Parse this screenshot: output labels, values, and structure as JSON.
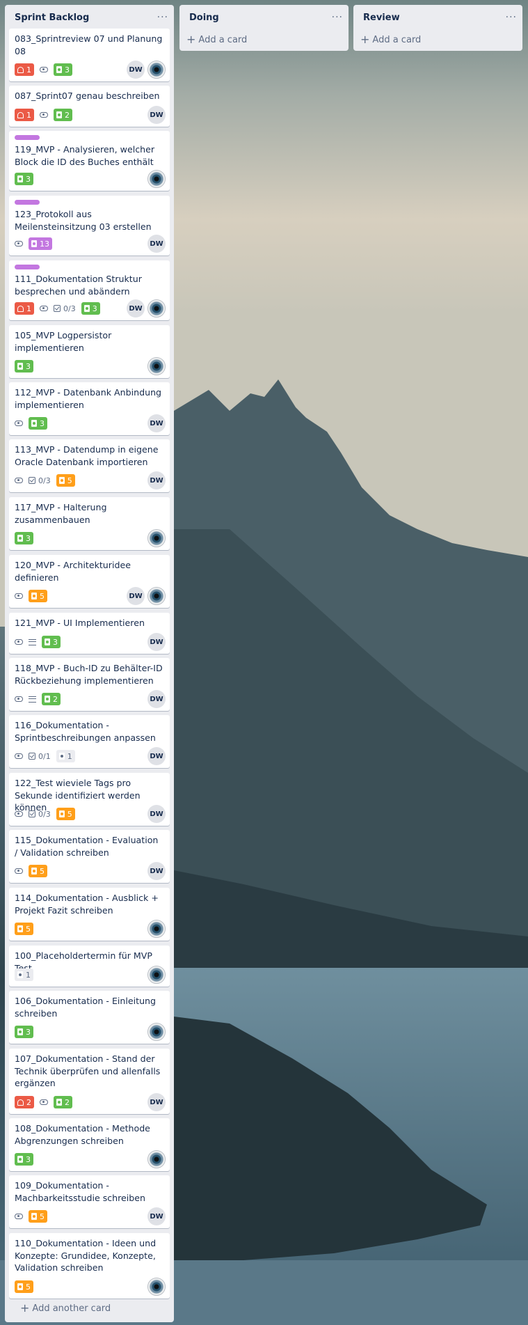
{
  "lists": [
    {
      "title": "Sprint Backlog",
      "add_label": "Add another card"
    },
    {
      "title": "Doing",
      "add_label": "Add a card"
    },
    {
      "title": "Review",
      "add_label": "Add a card"
    }
  ],
  "icons": {
    "menu": "ellipsis-icon",
    "add": "plus-icon",
    "watch": "eye-icon",
    "description": "description-icon",
    "checklist": "checklist-icon",
    "due": "bell-icon",
    "points": "story-points-icon"
  },
  "colors": {
    "red": "#eb5a46",
    "green": "#61bd4f",
    "orange": "#ff9f1a",
    "purple": "#c377e0",
    "list_bg": "#ebecf0"
  },
  "member_initials": "DW",
  "cards": [
    {
      "title": "083_Sprintreview 07 und Planung 08",
      "due": "1",
      "points": "3",
      "points_color": "green"
    },
    {
      "title": "087_Sprint07 genau beschreiben",
      "due": "1",
      "points": "2",
      "points_color": "green"
    },
    {
      "title": "119_MVP - Analysieren, welcher Block die ID des Buches enthält",
      "points": "3",
      "points_color": "green"
    },
    {
      "title": "123_Protokoll aus Meilensteinsitzung 03 erstellen",
      "points": "13",
      "points_color": "purple"
    },
    {
      "title": "111_Dokumentation Struktur besprechen und abändern",
      "due": "1",
      "checklist": "0/3",
      "points": "3",
      "points_color": "green"
    },
    {
      "title": "105_MVP Logpersistor implementieren",
      "points": "3",
      "points_color": "green"
    },
    {
      "title": "112_MVP - Datenbank Anbindung implementieren",
      "points": "3",
      "points_color": "green"
    },
    {
      "title": "113_MVP - Datendump in eigene Oracle Datenbank importieren",
      "checklist": "0/3",
      "points": "5",
      "points_color": "orange"
    },
    {
      "title": "117_MVP - Halterung zusammenbauen",
      "points": "3",
      "points_color": "green"
    },
    {
      "title": "120_MVP - Architekturidee definieren",
      "points": "5",
      "points_color": "orange"
    },
    {
      "title": "121_MVP - UI Implementieren",
      "points": "3",
      "points_color": "green"
    },
    {
      "title": "118_MVP - Buch-ID zu Behälter-ID Rückbeziehung implementieren",
      "points": "2",
      "points_color": "green"
    },
    {
      "title": "116_Dokumentation - Sprintbeschreibungen anpassen",
      "checklist": "0/1",
      "points": "1",
      "points_color": "grey"
    },
    {
      "title": "122_Test wieviele Tags pro Sekunde identifiziert werden können",
      "checklist": "0/3",
      "points": "5",
      "points_color": "orange"
    },
    {
      "title": "115_Dokumentation - Evaluation / Validation schreiben",
      "points": "5",
      "points_color": "orange"
    },
    {
      "title": "114_Dokumentation - Ausblick + Projekt Fazit schreiben",
      "points": "5",
      "points_color": "orange"
    },
    {
      "title": "100_Placeholdertermin für MVP Test",
      "points": "1",
      "points_color": "grey"
    },
    {
      "title": "106_Dokumentation - Einleitung schreiben",
      "points": "3",
      "points_color": "green"
    },
    {
      "title": "107_Dokumentation - Stand der Technik überprüfen und allenfalls ergänzen",
      "due": "2",
      "points": "2",
      "points_color": "green"
    },
    {
      "title": "108_Dokumentation - Methode Abgrenzungen schreiben",
      "points": "3",
      "points_color": "green"
    },
    {
      "title": "109_Dokumentation - Machbarkeitsstudie schreiben",
      "points": "5",
      "points_color": "orange"
    },
    {
      "title": "110_Dokumentation - Ideen und Konzepte: Grundidee, Konzepte, Validation schreiben",
      "points": "5",
      "points_color": "orange"
    }
  ]
}
